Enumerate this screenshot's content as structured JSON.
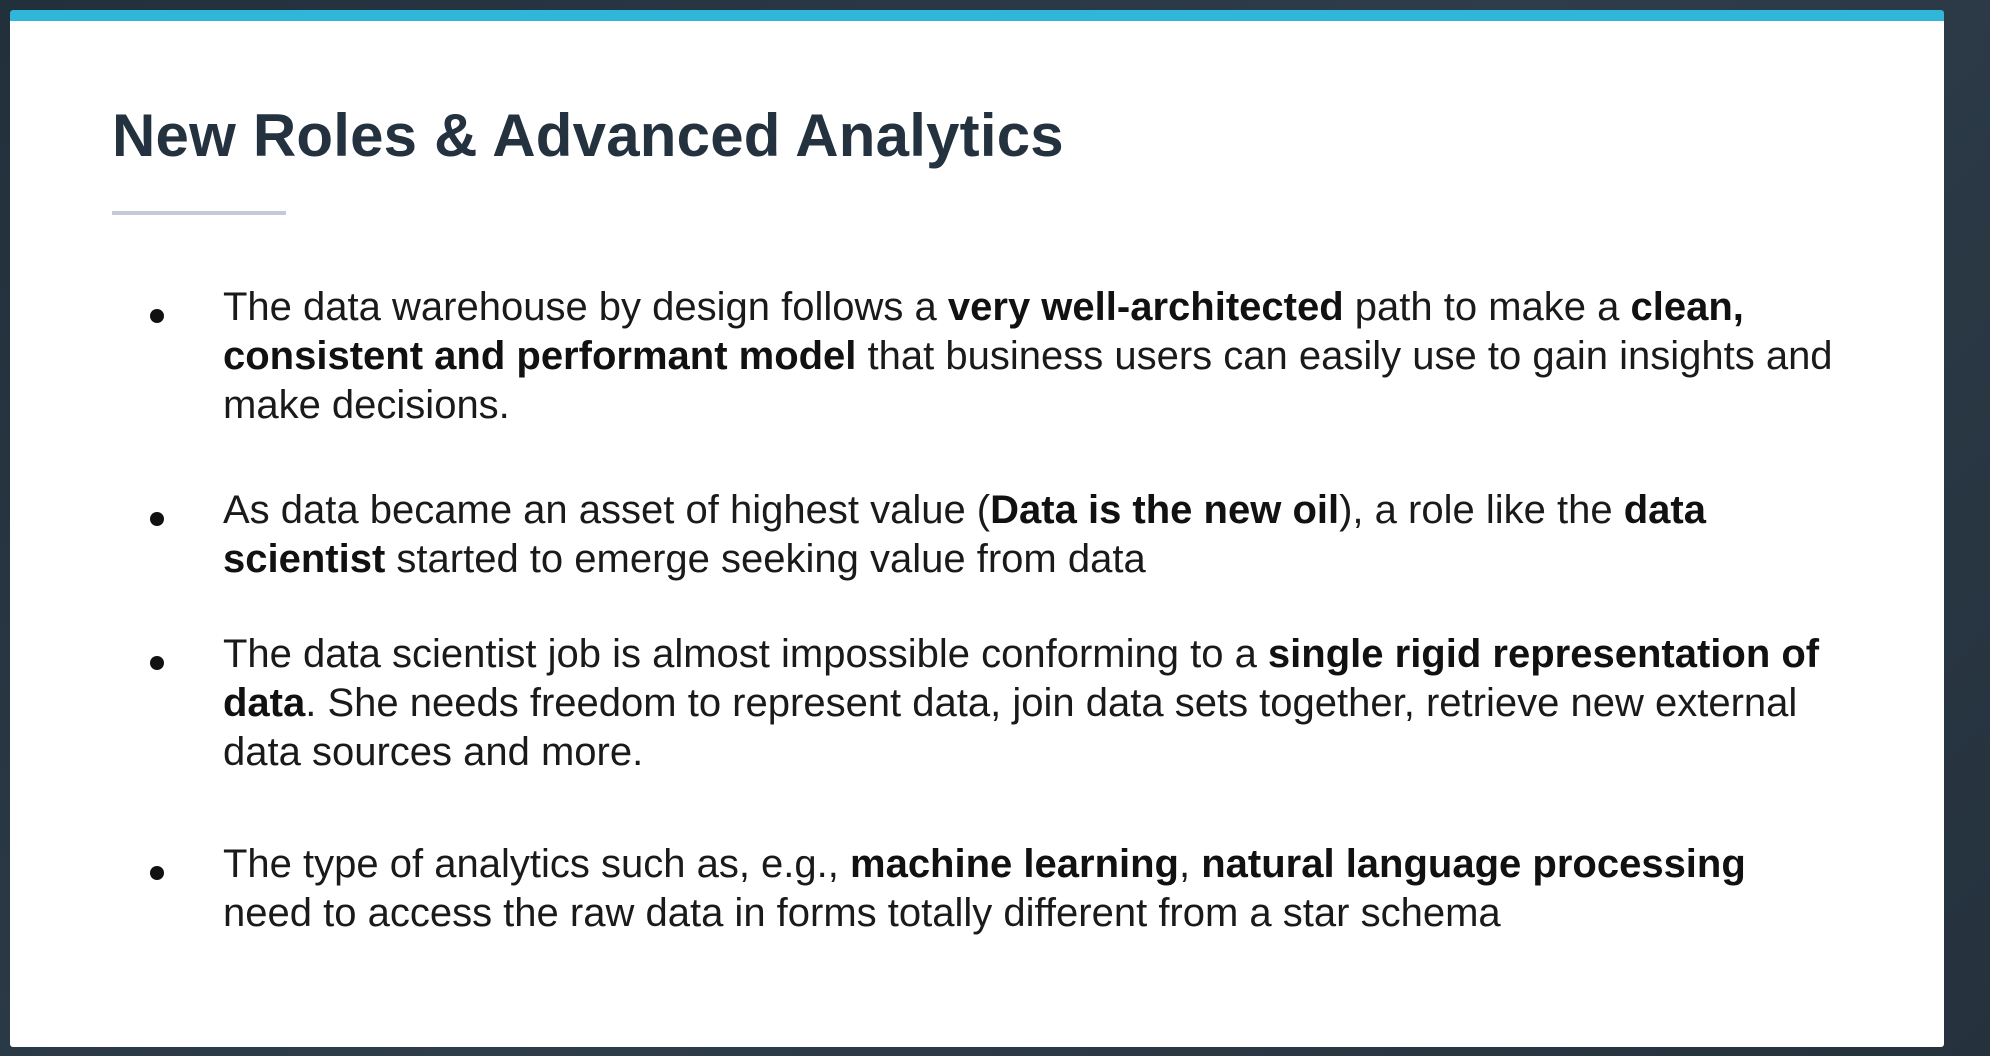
{
  "slide": {
    "title": "New Roles & Advanced Analytics",
    "bullets": [
      {
        "segments": [
          {
            "text": "The data  warehouse by design follows a ",
            "bold": false
          },
          {
            "text": "very well-architected",
            "bold": true
          },
          {
            "text": " path to make a ",
            "bold": false
          },
          {
            "text": "clean, consistent and performant model",
            "bold": true
          },
          {
            "text": " that business users can easily use to gain insights and make decisions.",
            "bold": false
          }
        ]
      },
      {
        "segments": [
          {
            "text": "As data became an asset of highest value (",
            "bold": false
          },
          {
            "text": "Data is the new oil",
            "bold": true
          },
          {
            "text": "), a role like the ",
            "bold": false
          },
          {
            "text": "data scientist",
            "bold": true
          },
          {
            "text": " started to emerge seeking value from data",
            "bold": false
          }
        ]
      },
      {
        "segments": [
          {
            "text": "The data scientist job is almost impossible conforming to a ",
            "bold": false
          },
          {
            "text": "single rigid representation of data",
            "bold": true
          },
          {
            "text": ". She needs freedom to represent data, join data sets together, retrieve new external data sources and more.",
            "bold": false
          }
        ]
      },
      {
        "segments": [
          {
            "text": "The type of analytics such as, e.g., ",
            "bold": false
          },
          {
            "text": "machine learning",
            "bold": true
          },
          {
            "text": ", ",
            "bold": false
          },
          {
            "text": "natural language processing",
            "bold": true
          },
          {
            "text": " need to access the raw data in forms totally different from a star schema",
            "bold": false
          }
        ]
      }
    ]
  },
  "colors": {
    "accent_bar": "#2fb6d9",
    "title": "#24323f",
    "rule": "#c3ccd5",
    "background": "#2b3a47"
  }
}
